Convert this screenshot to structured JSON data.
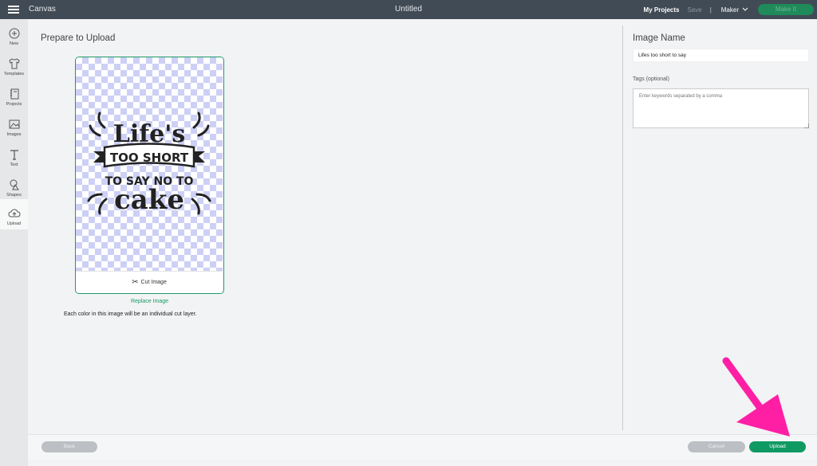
{
  "topbar": {
    "app_name": "Canvas",
    "doc_title": "Untitled",
    "my_projects": "My Projects",
    "save": "Save",
    "separator": "|",
    "machine": "Maker",
    "make": "Make It"
  },
  "sidebar": {
    "items": [
      {
        "label": "New",
        "icon": "plus-circle-icon"
      },
      {
        "label": "Templates",
        "icon": "tshirt-icon"
      },
      {
        "label": "Projects",
        "icon": "notebook-icon"
      },
      {
        "label": "Images",
        "icon": "image-icon"
      },
      {
        "label": "Text",
        "icon": "text-icon"
      },
      {
        "label": "Shapes",
        "icon": "shapes-icon"
      },
      {
        "label": "Upload",
        "icon": "cloud-upload-icon"
      }
    ],
    "active": "Upload"
  },
  "main": {
    "title": "Prepare to Upload",
    "preview_text": {
      "line1": "Life's",
      "line2": "TOO SHORT",
      "line3": "TO SAY NO TO",
      "line4": "cake"
    },
    "cut_label": "Cut Image",
    "replace_label": "Replace Image",
    "info": "Each color in this image will be an individual cut layer."
  },
  "right": {
    "image_name_label": "Image Name",
    "image_name_value": "Lifes too short to say",
    "tags_label": "Tags (optional)",
    "tags_placeholder": "Enter keywords separated by a comma"
  },
  "bottom": {
    "back": "Back",
    "cancel": "Cancel",
    "upload": "Upload"
  },
  "colors": {
    "accent": "#1a9b67",
    "topbar": "#414b55",
    "annotation": "#ff1fa5"
  }
}
